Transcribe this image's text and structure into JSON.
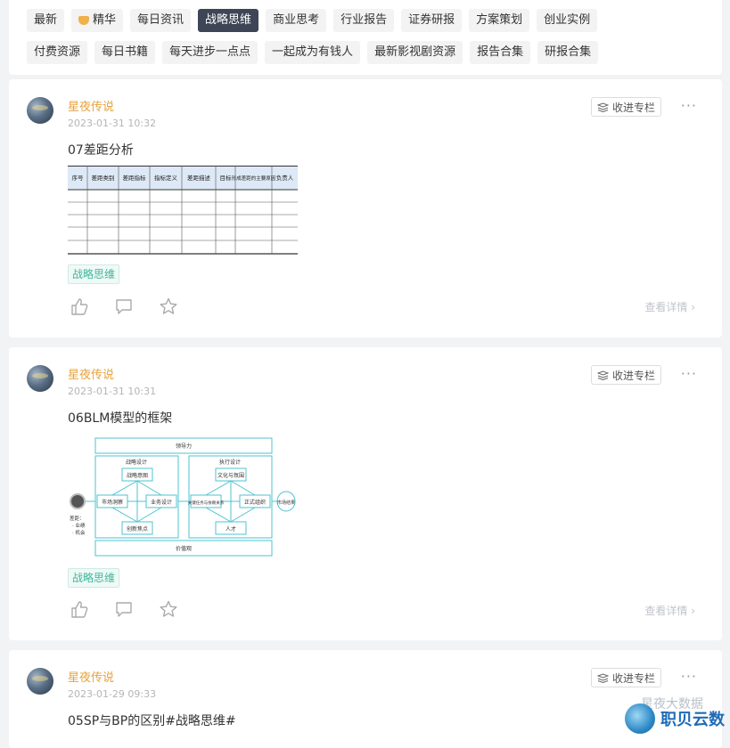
{
  "tags_row1": [
    {
      "label": "最新",
      "active": false,
      "gem": false
    },
    {
      "label": "精华",
      "active": false,
      "gem": true
    },
    {
      "label": "每日资讯",
      "active": false,
      "gem": false
    },
    {
      "label": "战略思维",
      "active": true,
      "gem": false
    },
    {
      "label": "商业思考",
      "active": false,
      "gem": false
    },
    {
      "label": "行业报告",
      "active": false,
      "gem": false
    },
    {
      "label": "证券研报",
      "active": false,
      "gem": false
    },
    {
      "label": "方案策划",
      "active": false,
      "gem": false
    },
    {
      "label": "创业实例",
      "active": false,
      "gem": false
    }
  ],
  "tags_row2": [
    {
      "label": "付费资源",
      "active": false,
      "gem": false
    },
    {
      "label": "每日书籍",
      "active": false,
      "gem": false
    },
    {
      "label": "每天进步一点点",
      "active": false,
      "gem": false
    },
    {
      "label": "一起成为有钱人",
      "active": false,
      "gem": false
    },
    {
      "label": "最新影视剧资源",
      "active": false,
      "gem": false
    },
    {
      "label": "报告合集",
      "active": false,
      "gem": false
    },
    {
      "label": "研报合集",
      "active": false,
      "gem": false
    }
  ],
  "posts": [
    {
      "author": "星夜传说",
      "time": "2023-01-31 10:32",
      "title": "07差距分析",
      "topic": "战略思维",
      "collect_label": "收进专栏",
      "more": "···",
      "detail": "查看详情",
      "gap_table_headers": [
        "序号",
        "差距类别",
        "差距指标",
        "指标定义",
        "差距描述",
        "目标",
        "形成差距的主要原因",
        "负责人"
      ]
    },
    {
      "author": "星夜传说",
      "time": "2023-01-31 10:31",
      "title": "06BLM模型的框架",
      "topic": "战略思维",
      "collect_label": "收进专栏",
      "more": "···",
      "detail": "查看详情",
      "blm": {
        "top": "领导力",
        "bottom": "价值观",
        "left_group": "战略设计",
        "right_group": "执行设计",
        "left_boxes": [
          "战略意图",
          "市场洞察",
          "业务设计",
          "创新焦点"
        ],
        "right_boxes": [
          "文化与氛围",
          "关键任务与依赖关系",
          "正式组织",
          "人才"
        ],
        "gap_lines": [
          "差距：",
          "· 业绩",
          "· 机会"
        ],
        "result": "市场结果"
      }
    },
    {
      "author": "星夜传说",
      "time": "2023-01-29 09:33",
      "title": "05SP与BP的区别#战略思维#",
      "collect_label": "收进专栏",
      "more": "···"
    }
  ],
  "watermark": {
    "brand": "职贝云数",
    "ghost": "星夜大数据"
  },
  "colors": {
    "accent_author": "#e6a23c",
    "active_tag": "#3e4556",
    "topic_tag": "#3fb59b",
    "diagram_line": "#4cc3cf"
  }
}
